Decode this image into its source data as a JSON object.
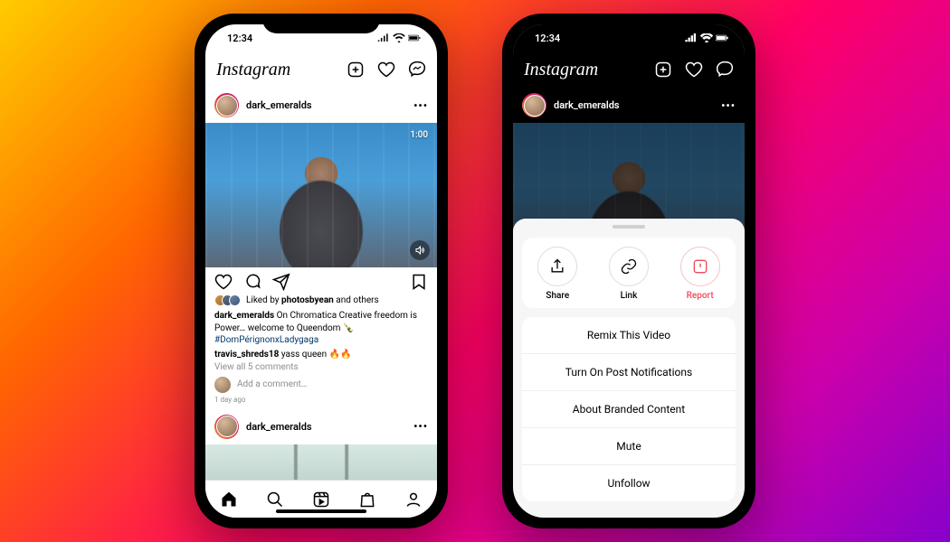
{
  "status": {
    "time": "12:34"
  },
  "app": {
    "name": "Instagram"
  },
  "post": {
    "username": "dark_emeralds",
    "duration": "1:00",
    "liked_by_prefix": "Liked by ",
    "liked_by_user": "photosbyean",
    "liked_by_suffix": " and others",
    "caption_user": "dark_emeralds",
    "caption_text": " On Chromatica Creative freedom is Power… welcome to Queendom 🍾",
    "hashtag": "#DomPérignonxLadygaga",
    "comment_user": "travis_shreds18",
    "comment_text": " yass queen 🔥🔥",
    "view_comments": "View all 5 comments",
    "add_comment": "Add a comment…",
    "timestamp": "1 day ago"
  },
  "post2": {
    "username": "dark_emeralds"
  },
  "sheet": {
    "top": [
      {
        "label": "Share",
        "icon": "share"
      },
      {
        "label": "Link",
        "icon": "link"
      },
      {
        "label": "Report",
        "icon": "report",
        "danger": true
      }
    ],
    "list": [
      "Remix This Video",
      "Turn On Post Notifications",
      "About Branded Content",
      "Mute",
      "Unfollow"
    ]
  }
}
